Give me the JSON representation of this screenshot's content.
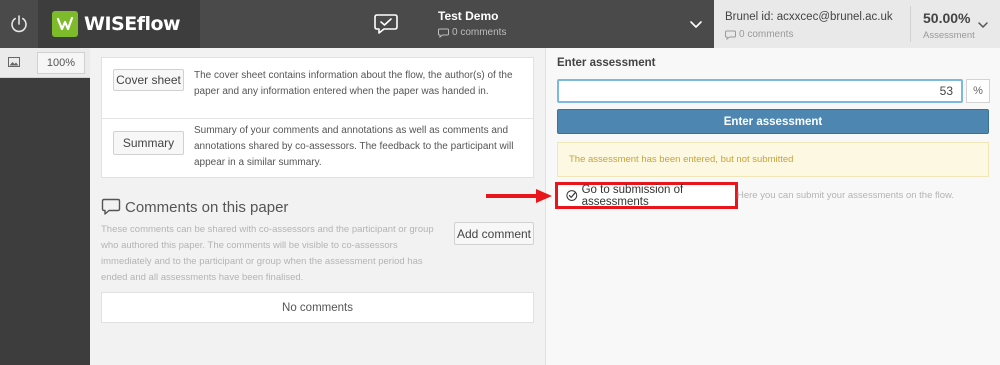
{
  "app": {
    "brand": "WISEflow",
    "flow_title": "Test Demo",
    "flow_comments": "0 comments"
  },
  "user": {
    "id_label": "Brunel id: acxxcec@brunel.ac.uk",
    "comments": "0 comments",
    "score": "50.00%",
    "score_label": "Assessment"
  },
  "viewer": {
    "zoom": "100%"
  },
  "documents": {
    "items": [
      {
        "button": "Cover sheet",
        "text": "The cover sheet contains information about the flow, the author(s) of the paper and any information entered when the paper was handed in."
      },
      {
        "button": "Summary",
        "text": "Summary of your comments and annotations as well as comments and annotations shared by co-assessors. The feedback to the participant will appear in a similar summary."
      }
    ]
  },
  "comments": {
    "title": "Comments on this paper",
    "description": "These comments can be shared with co-assessors and the participant or group who authored this paper. The comments will be visible to co-assessors immediately and to the participant or group when the assessment period has ended and all assessments have been finalised.",
    "add_button": "Add comment",
    "empty": "No comments"
  },
  "assessment": {
    "label": "Enter assessment",
    "value": "53",
    "unit": "%",
    "button": "Enter assessment",
    "status": "The assessment has been entered, but not submitted",
    "goto_link": "Go to submission of assessments",
    "hint": "Here you can submit your assessments on the flow."
  },
  "colors": {
    "topbar": "#4a4a4a",
    "brand_green": "#7dbb2a",
    "primary_blue": "#4e86b2",
    "highlight_red": "#e8161c",
    "warning_text": "#c7a33c"
  }
}
